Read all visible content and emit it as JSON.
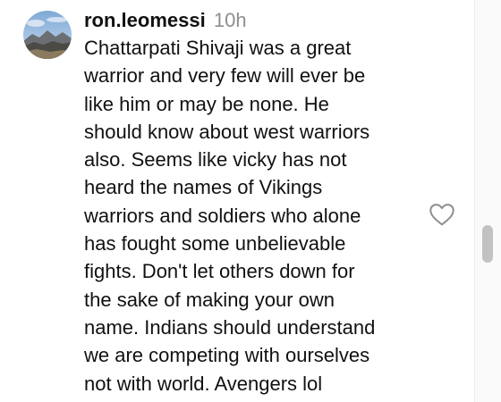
{
  "comment": {
    "username": "ron.leomessi",
    "timestamp": "10h",
    "avatar_icon": "profile-photo-mountain-landscape",
    "like_icon": "heart-outline-icon",
    "body_lines": [
      "Chattarpati Shivaji was a great",
      "warrior and very few will ever be",
      "like him or may be none. He",
      "should know about west warriors",
      "also. Seems like vicky has not",
      "heard the names of Vikings",
      "warriors and soldiers who alone",
      "has fought some unbelievable",
      "fights. Don't let others down for",
      "the sake of making your own",
      "name. Indians should understand",
      "we are competing with ourselves",
      "not with world. Avengers lol"
    ]
  },
  "colors": {
    "text": "#111111",
    "timestamp": "#8e8e8e",
    "icon": "#8e8e8e",
    "scroll_thumb": "#c2c2c2"
  }
}
